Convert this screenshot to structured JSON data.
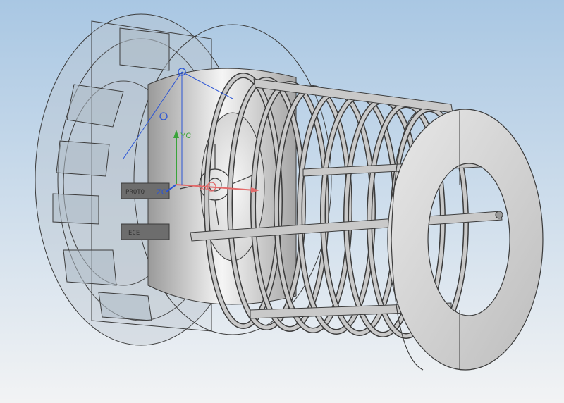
{
  "viewport": {
    "background_top": "#a9c7e3",
    "background_bottom": "#f2f3f4"
  },
  "triad": {
    "yc_label": "YC",
    "xc_label": "XC",
    "zc_label": "ZC",
    "colors": {
      "x": "#e36b6b",
      "y": "#3aa43a",
      "z": "#2b55d6"
    }
  },
  "model": {
    "name": "cylindrical cage assembly",
    "ring_count": 9,
    "stamps": [
      "PROTO",
      "ECE"
    ],
    "colors": {
      "metal": "#c9c9c9",
      "metal_dark": "#8a8a8a",
      "outline": "#3c3c3c",
      "ghost": "#b9c4cc"
    }
  }
}
